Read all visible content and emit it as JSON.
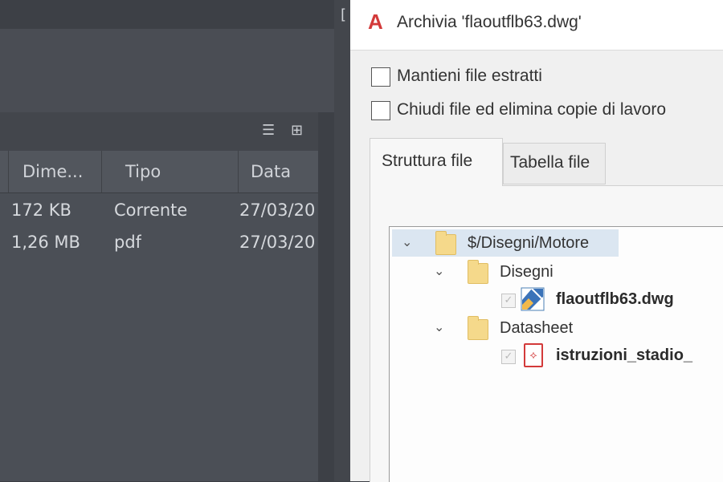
{
  "background_window": {
    "columns": [
      "Dime...",
      "Tipo",
      "Data"
    ],
    "rows": [
      {
        "size": "172 KB",
        "type": "Corrente",
        "date": "27/03/20"
      },
      {
        "size": "1,26 MB",
        "type": "pdf",
        "date": "27/03/20"
      }
    ],
    "icons": [
      "list-view-icon",
      "tree-view-icon"
    ]
  },
  "dialog": {
    "app_logo": "A",
    "title": "Archivia 'flaoutflb63.dwg'",
    "options": [
      {
        "label": "Mantieni file estratti",
        "checked": false
      },
      {
        "label": "Chiudi file ed elimina copie di lavoro",
        "checked": false
      }
    ],
    "tabs": [
      {
        "label": "Struttura file",
        "active": true
      },
      {
        "label": "Tabella file",
        "active": false
      }
    ],
    "tree": {
      "root": "$/Disegni/Motore",
      "folders": [
        {
          "name": "Disegni",
          "file": "flaoutflb63.dwg",
          "file_icon": "dwg-file-icon"
        },
        {
          "name": "Datasheet",
          "file": "istruzioni_stadio_",
          "file_icon": "pdf-file-icon"
        }
      ]
    },
    "colors": {
      "accent": "#d33a3a",
      "selection": "#dbe6f1",
      "folder": "#f5d98b"
    }
  }
}
